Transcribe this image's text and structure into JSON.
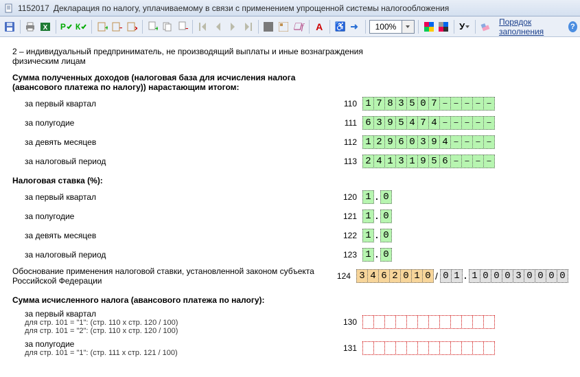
{
  "title": {
    "id": "1152017",
    "text": "Декларация по налогу, уплачиваемому в связи с применением упрощенной системы налогообложения"
  },
  "toolbar": {
    "zoom": "100%",
    "order_link": "Порядок заполнения"
  },
  "body": {
    "line2": "2 – индивидуальный предприниматель, не производящий выплаты и иные вознаграждения физическим лицам",
    "h_income": "Сумма полученных доходов (налоговая база для исчисления налога (авансового платежа по налогу)) нарастающим итогом:",
    "h_rate": "Налоговая ставка (%):",
    "h_reason": "Обоснование применения налоговой ставки, установленной законом субъекта Российской Федерации",
    "h_calc": "Сумма исчисленного налога (авансового платежа по налогу):",
    "hint101_1": "для стр. 101 = \"1\": (стр. 110 x стр. 120 / 100)",
    "hint101_2": "для стр. 101 = \"2\": (стр. 110 x стр. 120 / 100)",
    "hint101_1b": "для стр. 101 = \"1\": (стр. 111 x стр. 121 / 100)"
  },
  "rows": {
    "income": [
      {
        "label": "за первый квартал",
        "code": "110",
        "digits": [
          "1",
          "7",
          "8",
          "3",
          "5",
          "0",
          "7",
          "–",
          "–",
          "–",
          "–",
          "–"
        ]
      },
      {
        "label": "за полугодие",
        "code": "111",
        "digits": [
          "6",
          "3",
          "9",
          "5",
          "4",
          "7",
          "4",
          "–",
          "–",
          "–",
          "–",
          "–"
        ]
      },
      {
        "label": "за девять месяцев",
        "code": "112",
        "digits": [
          "1",
          "2",
          "9",
          "6",
          "0",
          "3",
          "9",
          "4",
          "–",
          "–",
          "–",
          "–"
        ]
      },
      {
        "label": "за налоговый период",
        "code": "113",
        "digits": [
          "2",
          "4",
          "1",
          "3",
          "1",
          "9",
          "5",
          "6",
          "–",
          "–",
          "–",
          "–"
        ]
      }
    ],
    "rate": [
      {
        "label": "за первый квартал",
        "code": "120",
        "int": "1",
        "dec": "0"
      },
      {
        "label": "за полугодие",
        "code": "121",
        "int": "1",
        "dec": "0"
      },
      {
        "label": "за девять месяцев",
        "code": "122",
        "int": "1",
        "dec": "0"
      },
      {
        "label": "за налоговый период",
        "code": "123",
        "int": "1",
        "dec": "0"
      }
    ],
    "reason": {
      "code": "124",
      "left_digits": [
        "3",
        "4",
        "6",
        "2",
        "0",
        "1",
        "0"
      ],
      "right_digits": [
        "0",
        "1",
        ".",
        "1",
        "0",
        "0",
        "0",
        "3",
        "0",
        "0",
        "0",
        "0"
      ]
    },
    "calc": [
      {
        "label": "за первый квартал",
        "code": "130"
      },
      {
        "label": "за полугодие",
        "code": "131"
      }
    ]
  }
}
